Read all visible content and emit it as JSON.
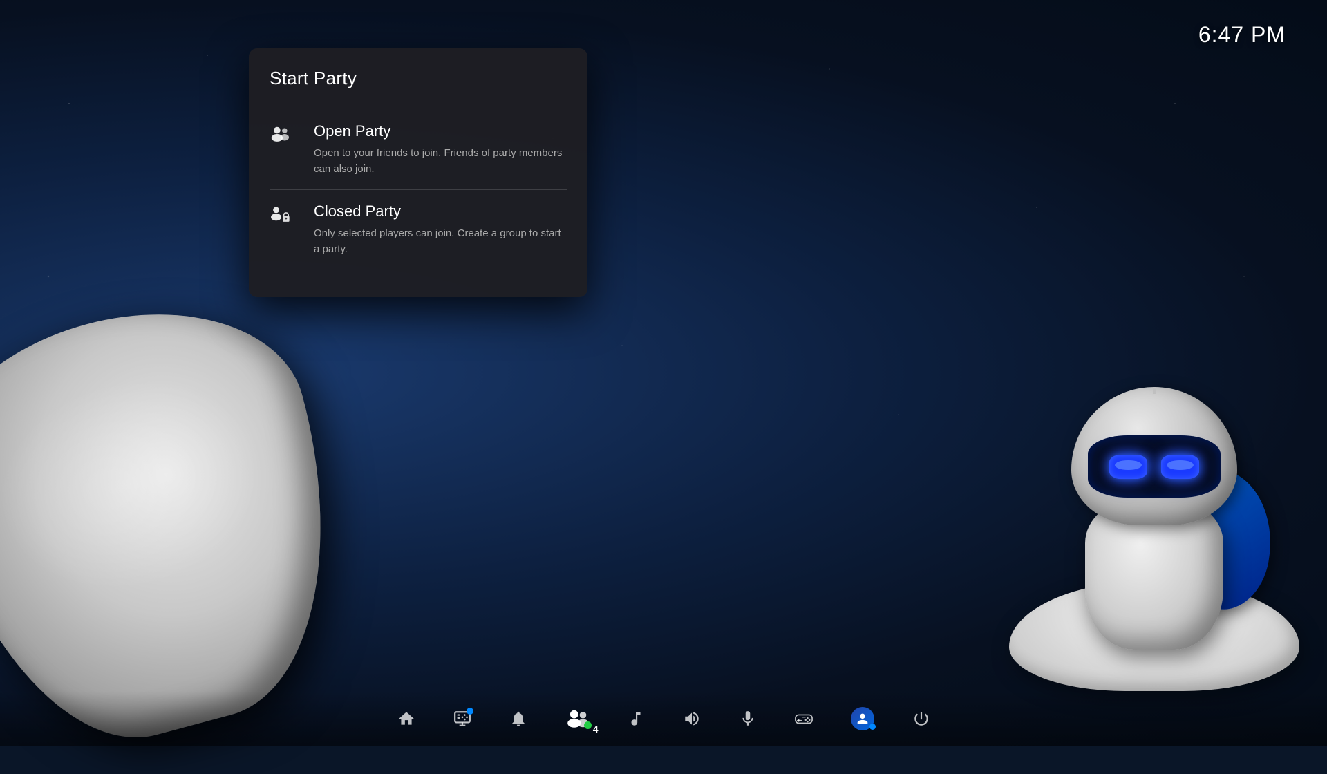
{
  "clock": {
    "time": "6:47 PM"
  },
  "modal": {
    "title": "Start Party",
    "options": [
      {
        "id": "open-party",
        "title": "Open Party",
        "description": "Open to your friends to join. Friends of party members can also join.",
        "icon": "open-party-icon"
      },
      {
        "id": "closed-party",
        "title": "Closed Party",
        "description": "Only selected players can join. Create a group to start a party.",
        "icon": "closed-party-icon"
      }
    ]
  },
  "taskbar": {
    "items": [
      {
        "id": "home",
        "icon": "home-icon",
        "label": "Home"
      },
      {
        "id": "game",
        "icon": "game-icon",
        "label": "Game"
      },
      {
        "id": "notifications",
        "icon": "bell-icon",
        "label": "Notifications"
      },
      {
        "id": "friends",
        "icon": "friends-icon",
        "label": "Friends",
        "badge": "4",
        "dot_color": "green"
      },
      {
        "id": "music",
        "icon": "music-icon",
        "label": "Music"
      },
      {
        "id": "volume",
        "icon": "volume-icon",
        "label": "Volume"
      },
      {
        "id": "mic",
        "icon": "mic-icon",
        "label": "Microphone"
      },
      {
        "id": "controller",
        "icon": "controller-icon",
        "label": "Controller"
      },
      {
        "id": "account",
        "icon": "account-icon",
        "label": "Account",
        "dot_color": "blue"
      },
      {
        "id": "power",
        "icon": "power-icon",
        "label": "Power"
      }
    ]
  },
  "colors": {
    "accent": "#0070d1",
    "bg_modal": "rgba(30,30,35,0.97)",
    "text_primary": "#ffffff",
    "text_secondary": "#aaaaaa",
    "divider": "rgba(255,255,255,0.15)"
  }
}
